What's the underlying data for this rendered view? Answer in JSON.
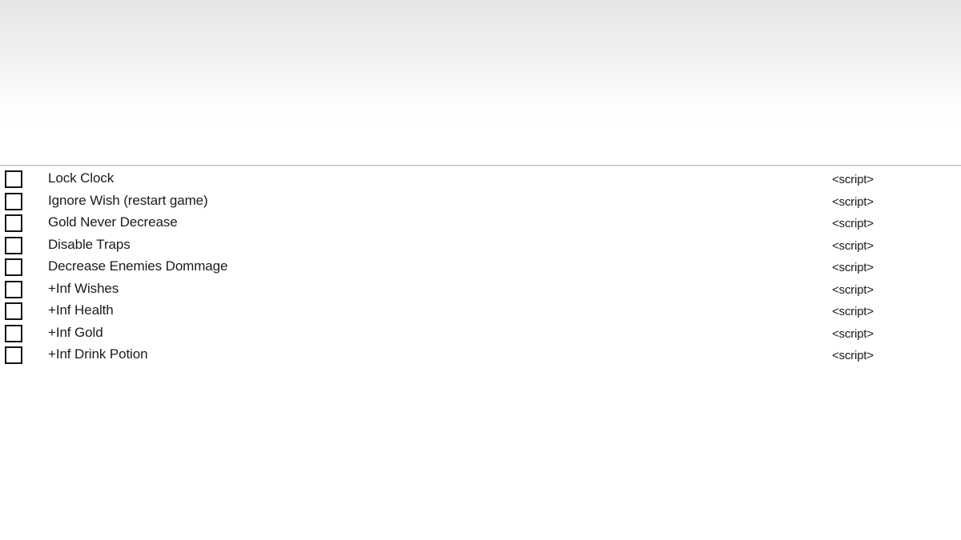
{
  "window": {
    "background_color": "#ffffff",
    "band_top_color": "#e6e6e6",
    "band_bottom_color": "#ffffff",
    "divider_color": "#bfbfbf",
    "text_color": "#1b1b1b"
  },
  "cheat_list": {
    "script_label": "<script>",
    "items": [
      {
        "label": "Lock Clock",
        "script": "<script>",
        "checked": false
      },
      {
        "label": "Ignore Wish (restart game)",
        "script": "<script>",
        "checked": false
      },
      {
        "label": "Gold Never Decrease",
        "script": "<script>",
        "checked": false
      },
      {
        "label": "Disable Traps",
        "script": "<script>",
        "checked": false
      },
      {
        "label": "Decrease Enemies Dommage",
        "script": "<script>",
        "checked": false
      },
      {
        "label": "+Inf Wishes",
        "script": "<script>",
        "checked": false
      },
      {
        "label": "+Inf Health",
        "script": "<script>",
        "checked": false
      },
      {
        "label": "+Inf Gold",
        "script": "<script>",
        "checked": false
      },
      {
        "label": "+Inf Drink Potion",
        "script": "<script>",
        "checked": false
      }
    ]
  }
}
